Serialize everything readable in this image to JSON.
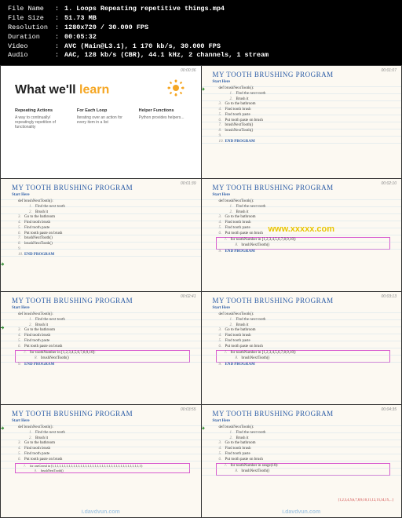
{
  "fileinfo": {
    "rows": [
      {
        "label": "File Name",
        "value": "1. Loops Repeating repetitive things.mp4"
      },
      {
        "label": "File Size",
        "value": "51.73 MB"
      },
      {
        "label": "Resolution",
        "value": "1280x720 / 30.000 FPS"
      },
      {
        "label": "Duration",
        "value": "00:05:32"
      },
      {
        "label": "Video",
        "value": "AVC (Main@L3.1), 1 170 kb/s, 30.000 FPS"
      },
      {
        "label": "Audio",
        "value": "AAC, 128 kb/s (CBR), 44.1 kHz, 2 channels, 1 stream"
      }
    ]
  },
  "slide1": {
    "timestamp": "00:00:36",
    "title_prefix": "What we'll ",
    "title_accent": "learn",
    "cols": [
      {
        "h": "Repeating Actions",
        "t": "A way to continually/ repeatingly repetition of functionality"
      },
      {
        "h": "For Each Loop",
        "t": "Iterating over an action for every item in a list"
      },
      {
        "h": "Helper Functions",
        "t": "Python provides helpers..."
      }
    ]
  },
  "program_title": "MY TOOTH BRUSHING PROGRAM",
  "start_here": "Start Here",
  "fn_def": "def brushNextTooth():",
  "s_find_next": "Find the next tooth",
  "s_brush_it": "Brush it",
  "s_bathroom": "Go to the bathroom",
  "s_find_brush": "Find tooth brush",
  "s_find_paste": "Find tooth paste",
  "s_put_paste": "Put tooth paste on brush",
  "s_call1": "brushNextTooth()",
  "s_call2": "brushNextTooth()",
  "end_prog": "END PROGRAM",
  "for_loop_short": "for toothNumber in [1,2,3,4,5,6,7,8,9,10]:",
  "for_loop_long": "for oneCereal in [1,1,1,1,1,1,1,1,1,1,1,1,1,1,1,1,1,1,1,1,1,1,1,1,1,1,1,1,1,1,1,1,1,1,1,1,1,1]:",
  "for_range": "for toothNumber in range(10):",
  "red_list": "[1,2,3,4,5,6,7,8,9,10,11,12,13,14,15,...]",
  "ts": {
    "c2": "00:01:07",
    "c3": "00:01:39",
    "c4": "00:02:10",
    "c5": "00:02:41",
    "c6": "00:03:13",
    "c7": "00:03:55",
    "c8": "00:04:35"
  },
  "watermark_center": "www.xxxxx.com",
  "watermark_bottom": "i.davdvun.com"
}
